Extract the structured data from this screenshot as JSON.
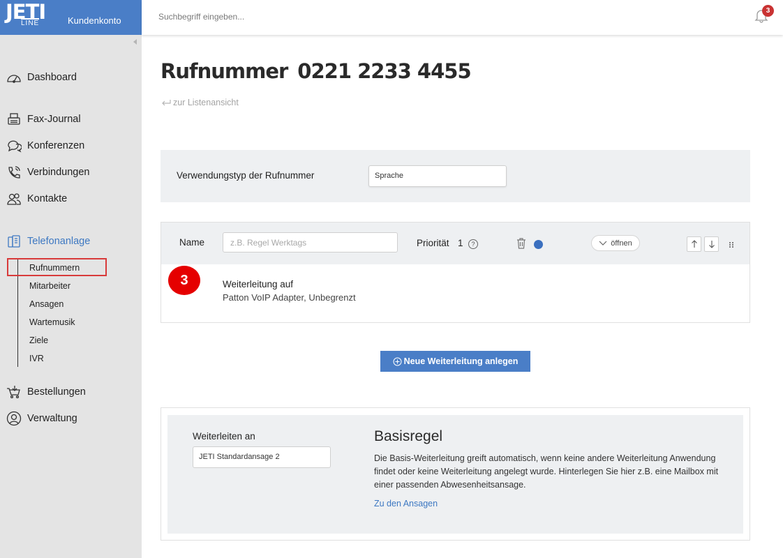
{
  "brand": {
    "logo_top": "JETI",
    "logo_bottom": "LINE",
    "account_label": "Kundenkonto",
    "color": "#4a7ec7"
  },
  "search": {
    "placeholder": "Suchbegriff eingeben..."
  },
  "notifications": {
    "count": "3"
  },
  "sidebar": {
    "items": [
      {
        "label": "Dashboard",
        "icon": "speedometer-icon"
      },
      {
        "label": "Fax-Journal",
        "icon": "fax-icon"
      },
      {
        "label": "Konferenzen",
        "icon": "chat-icon"
      },
      {
        "label": "Verbindungen",
        "icon": "phone-icon"
      },
      {
        "label": "Kontakte",
        "icon": "contacts-icon"
      },
      {
        "label": "Telefonanlage",
        "icon": "pbx-icon",
        "active": true
      },
      {
        "label": "Bestellungen",
        "icon": "cart-icon"
      },
      {
        "label": "Verwaltung",
        "icon": "user-circle-icon"
      }
    ],
    "subitems": [
      "Rufnummern",
      "Mitarbeiter",
      "Ansagen",
      "Wartemusik",
      "Ziele",
      "IVR"
    ],
    "selected_subitem": "Rufnummern"
  },
  "page": {
    "title": "Rufnummer",
    "number": "0221 2233 4455",
    "back_link": "zur Listenansicht"
  },
  "usage": {
    "label": "Verwendungstyp der Rufnummer",
    "value": "Sprache"
  },
  "rule": {
    "name_label": "Name",
    "name_placeholder": "z.B. Regel Werktags",
    "priority_label": "Priorität",
    "priority_value": "1",
    "help": "?",
    "open_label": "öffnen",
    "badge": "3",
    "forward_title": "Weiterleitung auf",
    "forward_detail": "Patton VoIP Adapter, Unbegrenzt",
    "status_color": "#3a6fbf"
  },
  "new_forward_button": "Neue Weiterleitung anlegen",
  "base_rule": {
    "forward_label": "Weiterleiten an",
    "forward_value": "JETI Standardansage 2",
    "title": "Basisregel",
    "description": "Die Basis-Weiterleitung greift automatisch, wenn keine andere Weiterleitung Anwendung findet oder keine Weiterleitung angelegt wurde. Hinterlegen Sie hier z.B. eine Mailbox mit einer passenden Abwesenheitsansage.",
    "link": "Zu den Ansagen"
  }
}
